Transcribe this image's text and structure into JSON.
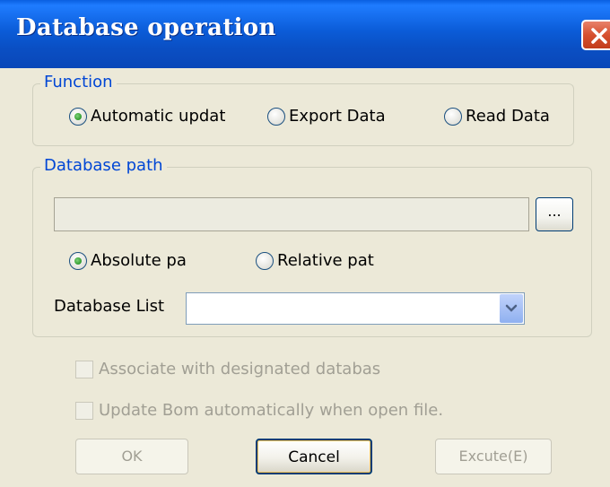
{
  "window": {
    "title": "Database operation"
  },
  "function_group": {
    "legend": "Function",
    "options": [
      {
        "label": "Automatic updat",
        "selected": true
      },
      {
        "label": "Export Data",
        "selected": false
      },
      {
        "label": "Read Data",
        "selected": false
      }
    ]
  },
  "path_group": {
    "legend": "Database path",
    "path_value": "",
    "browse_label": "...",
    "path_modes": [
      {
        "label": "Absolute pa",
        "selected": true
      },
      {
        "label": "Relative pat",
        "selected": false
      }
    ],
    "database_list_label": "Database List",
    "database_list_value": ""
  },
  "options": {
    "associate_label": "Associate with designated databas",
    "update_bom_label": "Update Bom automatically when open file."
  },
  "buttons": {
    "ok": "OK",
    "cancel": "Cancel",
    "execute": "Excute(E)"
  }
}
